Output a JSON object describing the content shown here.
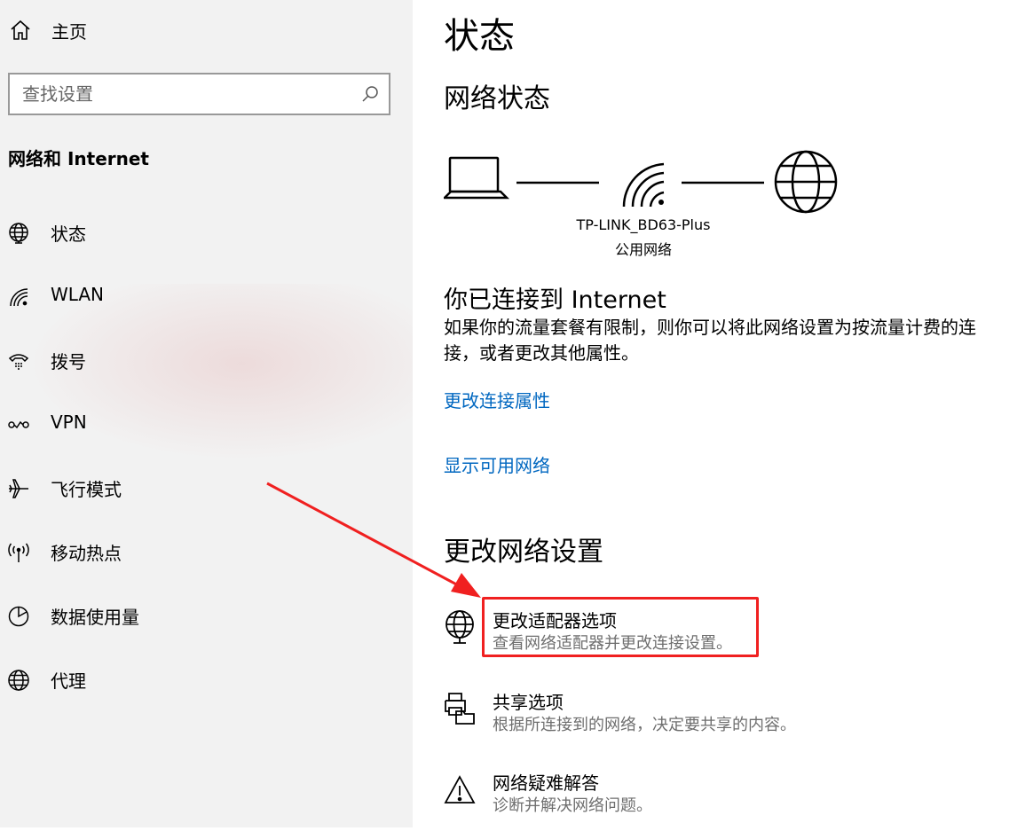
{
  "sidebar": {
    "home_label": "主页",
    "search_placeholder": "查找设置",
    "section_title": "网络和 Internet",
    "items": [
      {
        "label": "状态",
        "icon": "globe-status-icon"
      },
      {
        "label": "WLAN",
        "icon": "wifi-icon"
      },
      {
        "label": "拨号",
        "icon": "dialup-icon"
      },
      {
        "label": "VPN",
        "icon": "vpn-icon"
      },
      {
        "label": "飞行模式",
        "icon": "airplane-icon"
      },
      {
        "label": "移动热点",
        "icon": "hotspot-icon"
      },
      {
        "label": "数据使用量",
        "icon": "data-usage-icon"
      },
      {
        "label": "代理",
        "icon": "proxy-globe-icon"
      }
    ]
  },
  "main": {
    "title": "状态",
    "network_status_title": "网络状态",
    "network": {
      "ssid": "TP-LINK_BD63-Plus",
      "type": "公用网络"
    },
    "connected_title": "你已连接到 Internet",
    "description": "如果你的流量套餐有限制，则你可以将此网络设置为按流量计费的连接，或者更改其他属性。",
    "links": {
      "change_connection_properties": "更改连接属性",
      "show_available_networks": "显示可用网络"
    },
    "change_settings_title": "更改网络设置",
    "options": [
      {
        "title": "更改适配器选项",
        "subtitle": "查看网络适配器并更改连接设置。",
        "icon": "adapter-globe-icon"
      },
      {
        "title": "共享选项",
        "subtitle": "根据所连接到的网络，决定要共享的内容。",
        "icon": "sharing-icon"
      },
      {
        "title": "网络疑难解答",
        "subtitle": "诊断并解决网络问题。",
        "icon": "warning-icon"
      }
    ]
  },
  "colors": {
    "link": "#0067c0",
    "highlight": "#f02020",
    "sidebar_bg": "#f2f2f2"
  }
}
